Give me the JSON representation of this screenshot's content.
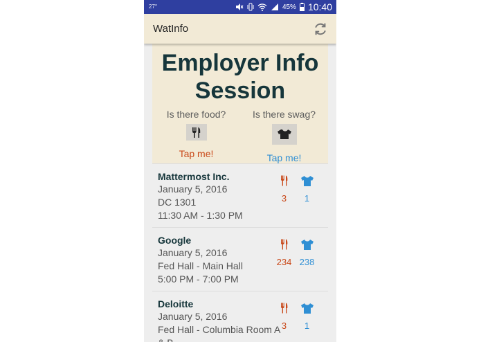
{
  "statusbar": {
    "left_text": "27°",
    "battery": "45%",
    "time": "10:40"
  },
  "appbar": {
    "title": "WatInfo",
    "refresh_icon": "refresh-icon"
  },
  "hero": {
    "title": "Employer Info Session",
    "food_question": "Is there food?",
    "swag_question": "Is there swag?",
    "food_tap": "Tap me!",
    "swag_tap": "Tap me!"
  },
  "colors": {
    "status_bar": "#2f3fa0",
    "app_bar": "#f2ead6",
    "title_text": "#16363b",
    "food_accent": "#c9491a",
    "swag_accent": "#2f8fd4"
  },
  "sessions": [
    {
      "name": "Mattermost Inc.",
      "date": "January 5, 2016",
      "location": "DC 1301",
      "time": "11:30 AM - 1:30 PM",
      "food_count": "3",
      "swag_count": "1"
    },
    {
      "name": "Google",
      "date": "January 5, 2016",
      "location": "Fed Hall - Main Hall",
      "time": "5:00 PM - 7:00 PM",
      "food_count": "234",
      "swag_count": "238"
    },
    {
      "name": "Deloitte",
      "date": "January 5, 2016",
      "location": "Fed Hall - Columbia Room A & B",
      "time": "",
      "food_count": "3",
      "swag_count": "1"
    }
  ]
}
